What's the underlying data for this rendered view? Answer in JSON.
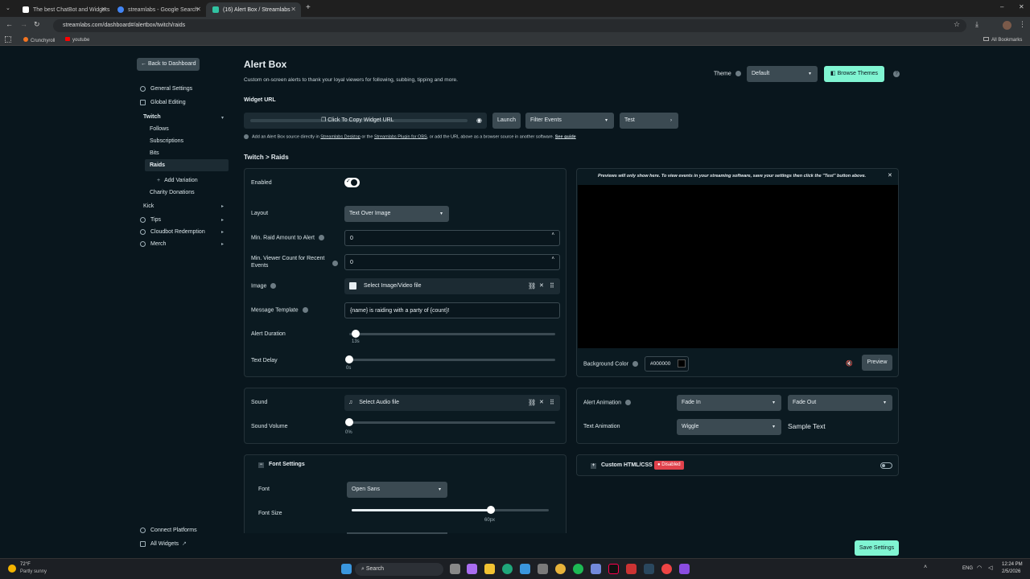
{
  "browser": {
    "tabs": [
      {
        "title": "The best ChatBot and Widgets",
        "color": "#ffffff"
      },
      {
        "title": "streamlabs - Google Search",
        "color": "#4285f4"
      },
      {
        "title": "(16) Alert Box / Streamlabs",
        "color": "#31c3a2"
      }
    ],
    "url": "streamlabs.com/dashboard#/alertbox/twitch/raids",
    "bookmarks": [
      "Crunchyroll",
      "youtube"
    ],
    "all_bookmarks": "All Bookmarks"
  },
  "sidebar": {
    "back_label": "Back to Dashboard",
    "items": [
      {
        "label": "General Settings",
        "icon": "gear-icon"
      },
      {
        "label": "Global Editing",
        "icon": "globe-icon"
      }
    ],
    "twitch": {
      "label": "Twitch",
      "children": [
        "Follows",
        "Subscriptions",
        "Bits",
        "Raids"
      ],
      "add_variation": "Add Variation",
      "charity": "Charity Donations"
    },
    "more": [
      {
        "label": "Kick"
      },
      {
        "label": "Tips",
        "icon": "tag-icon"
      },
      {
        "label": "Cloudbot Redemption",
        "icon": "bot-icon"
      },
      {
        "label": "Merch",
        "icon": "shirt-icon"
      }
    ],
    "connect_platforms": "Connect Platforms",
    "all_widgets": "All Widgets"
  },
  "header": {
    "title": "Alert Box",
    "subtitle": "Custom on-screen alerts to thank your loyal viewers for following, subbing, tipping and more.",
    "theme_label": "Theme",
    "theme_value": "Default",
    "browse_themes": "Browse Themes"
  },
  "widget": {
    "url_label": "Widget URL",
    "copy_label": "Click To Copy Widget URL",
    "launch": "Launch",
    "filter": "Filter Events",
    "test": "Test",
    "note_a": "Add an Alert Box source directly in ",
    "note_link1": "Streamlabs Desktop",
    "note_b": " or the ",
    "note_link2": "Streamlabs Plugin for OBS",
    "note_c": ", or add the URL above as a browser source in another software. ",
    "note_link3": "See guide"
  },
  "section_title": "Twitch > Raids",
  "settings": {
    "enabled": "Enabled",
    "layout": "Layout",
    "layout_value": "Text Over Image",
    "min_raid": "Min. Raid Amount to Alert",
    "min_raid_value": "0",
    "min_viewer": "Min. Viewer Count for Recent Events",
    "min_viewer_value": "0",
    "image": "Image",
    "image_value": "Select Image/Video file",
    "message": "Message Template",
    "message_value": "{name} is raiding with a party of {count}!",
    "duration": "Alert Duration",
    "duration_value": "13s",
    "delay": "Text Delay",
    "delay_value": "0s"
  },
  "preview": {
    "notice": "Previews will only show here. To view events in your streaming software, save your settings then click the \"Test\" button above.",
    "bg_label": "Background Color",
    "bg_value": "#000000",
    "preview_btn": "Preview"
  },
  "sound": {
    "label": "Sound",
    "value": "Select Audio file",
    "volume": "Sound Volume",
    "volume_value": "0%"
  },
  "animation": {
    "alert_label": "Alert Animation",
    "fade_in": "Fade In",
    "fade_out": "Fade Out",
    "text_label": "Text Animation",
    "text_value": "Wiggle",
    "sample": "Sample Text"
  },
  "font": {
    "header": "Font Settings",
    "font_label": "Font",
    "font_value": "Open Sans",
    "size_label": "Font Size",
    "size_value": "60px"
  },
  "custom": {
    "label": "Custom HTML/CSS",
    "badge": "Disabled"
  },
  "save": "Save Settings",
  "taskbar": {
    "weather_temp": "72°F",
    "weather_desc": "Partly sunny",
    "search": "Search",
    "lang": "ENG",
    "time": "12:24 PM",
    "date": "2/5/2026"
  }
}
